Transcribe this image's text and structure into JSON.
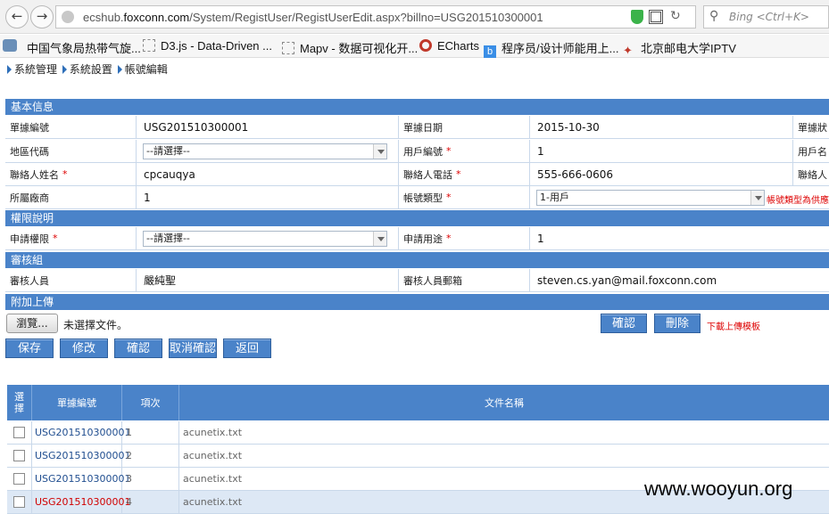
{
  "browser": {
    "url_prefix": "ecshub.",
    "url_domain": "foxconn.com",
    "url_path": "/System/RegistUser/RegistUserEdit.aspx?billno=USG201510300001",
    "search_placeholder": "Bing <Ctrl+K>",
    "bookmarks": [
      {
        "label": "中国气象局热带气旋...",
        "icon": "globe-icon"
      },
      {
        "label": "D3.js - Data-Driven ...",
        "icon": "page-icon"
      },
      {
        "label": "Mapv - 数据可视化开...",
        "icon": "page-icon"
      },
      {
        "label": "ECharts",
        "icon": "echarts-icon"
      },
      {
        "label": "程序员/设计师能用上...",
        "icon": "b-icon"
      },
      {
        "label": "北京邮电大学IPTV",
        "icon": "butterfly-icon"
      }
    ]
  },
  "breadcrumb": [
    "系統管理",
    "系統設置",
    "帳號編輯"
  ],
  "sections": {
    "basic": "基本信息",
    "permission": "權限說明",
    "review": "審核組",
    "upload": "附加上傳"
  },
  "form": {
    "bill_no_label": "單據編號",
    "bill_no": "USG201510300001",
    "bill_date_label": "單據日期",
    "bill_date": "2015-10-30",
    "bill_status_label": "單據狀",
    "region_label": "地區代碼",
    "region_value": "--請選擇--",
    "user_no_label": "用戶編號",
    "user_no": "1",
    "user_name_label": "用戶名",
    "contact_name_label": "聯絡人姓名",
    "contact_name": "cpcauqya",
    "contact_phone_label": "聯絡人電話",
    "contact_phone": "555-666-0606",
    "contact_mail_label": "聯絡人",
    "vendor_label": "所屬廠商",
    "vendor": "1",
    "account_type_label": "帳號類型",
    "account_type_value": "1-用戶",
    "account_type_note": "帳號類型為供應",
    "perm_label": "申請權限",
    "perm_value": "--請選擇--",
    "purpose_label": "申請用途",
    "purpose": "1",
    "reviewer_label": "審核人員",
    "reviewer": "嚴純聖",
    "reviewer_mail_label": "審核人員郵箱",
    "reviewer_mail": "steven.cs.yan@mail.foxconn.com",
    "browse_label": "瀏覽...",
    "no_file": "未選擇文件。",
    "confirm_upload": "確認",
    "delete": "刪除",
    "download_template": "下載上傳模板"
  },
  "toolbar": [
    "保存",
    "修改",
    "確認",
    "取消確認",
    "返回"
  ],
  "grid": {
    "headers": [
      "選擇",
      "單據編號",
      "項次",
      "文件名稱"
    ],
    "rows": [
      {
        "bill": "USG201510300001",
        "item": "1",
        "file": "acunetix.txt"
      },
      {
        "bill": "USG201510300001",
        "item": "2",
        "file": "acunetix.txt"
      },
      {
        "bill": "USG201510300001",
        "item": "3",
        "file": "acunetix.txt"
      },
      {
        "bill": "USG201510300001",
        "item": "4",
        "file": "acunetix.txt"
      }
    ]
  },
  "watermark": "www.wooyun.org",
  "colors": {
    "header_blue": "#4a83c9",
    "link_blue": "#1f4d8f",
    "highlight_red": "#d00000"
  }
}
